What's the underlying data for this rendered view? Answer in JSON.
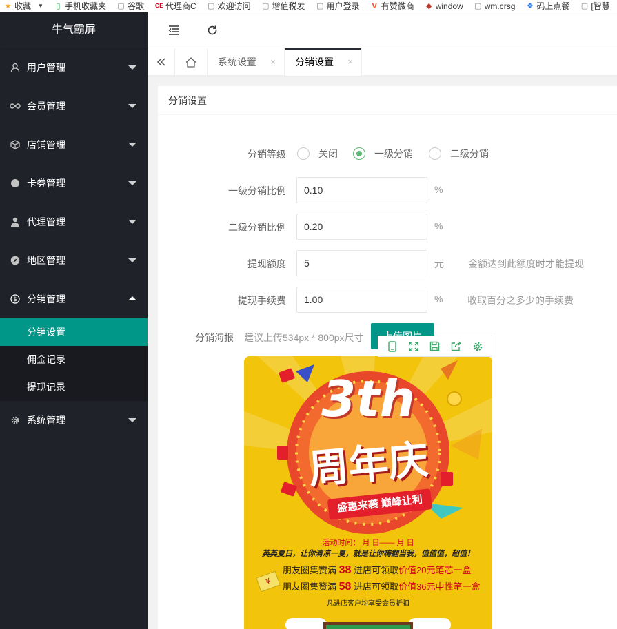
{
  "bookmarks": [
    {
      "icon": "star-icon",
      "label": "收藏"
    },
    {
      "icon": "phone-icon",
      "label": "手机收藏夹"
    },
    {
      "icon": "page-icon",
      "label": "谷歌"
    },
    {
      "icon": "ge-logo-icon",
      "label": "代理商C"
    },
    {
      "icon": "page-icon",
      "label": "欢迎访问"
    },
    {
      "icon": "page-icon",
      "label": "增值税发"
    },
    {
      "icon": "page-icon",
      "label": "用户登录"
    },
    {
      "icon": "v-logo-icon",
      "label": "有赞微商"
    },
    {
      "icon": "shield-logo-icon",
      "label": "window"
    },
    {
      "icon": "page-icon",
      "label": "wm.crsg"
    },
    {
      "icon": "cluster-icon",
      "label": "码上点餐"
    },
    {
      "icon": "page-icon",
      "label": "[智慧"
    }
  ],
  "sidebar": {
    "logo": "牛气霸屏",
    "menus": [
      {
        "icon": "user-icon",
        "label": "用户管理"
      },
      {
        "icon": "infinity-icon",
        "label": "会员管理"
      },
      {
        "icon": "box-icon",
        "label": "店铺管理"
      },
      {
        "icon": "circle-icon",
        "label": "卡劵管理"
      },
      {
        "icon": "person-icon",
        "label": "代理管理"
      },
      {
        "icon": "compass-icon",
        "label": "地区管理"
      },
      {
        "icon": "dollar-icon",
        "label": "分销管理"
      }
    ],
    "submenu": [
      "分销设置",
      "佣金记录",
      "提现记录"
    ],
    "last_menu": {
      "icon": "gear-icon",
      "label": "系统管理"
    }
  },
  "tabs": [
    {
      "label": "系统设置",
      "close": "×"
    },
    {
      "label": "分销设置",
      "close": "×"
    }
  ],
  "card": {
    "title": "分销设置",
    "level_label": "分销等级",
    "level_options": [
      "关闭",
      "一级分销",
      "二级分销"
    ],
    "level_selected": "一级分销",
    "rate1_label": "一级分销比例",
    "rate1_value": "0.10",
    "rate1_unit": "%",
    "rate2_label": "二级分销比例",
    "rate2_value": "0.20",
    "rate2_unit": "%",
    "limit_label": "提现额度",
    "limit_value": "5",
    "limit_unit": "元",
    "limit_hint": "金额达到此额度时才能提现",
    "fee_label": "提现手续费",
    "fee_value": "1.00",
    "fee_unit": "%",
    "fee_hint": "收取百分之多少的手续费",
    "poster_label": "分销海报",
    "poster_hint": "建议上传534px * 800px尺寸",
    "upload_button": "上传图片"
  },
  "poster": {
    "big_num": "3th",
    "big_title": "周年庆",
    "ribbon": "盛惠来袭  巅峰让利",
    "date_line": "活动时间：   月    日——    月    日",
    "slogan": "英英夏日，让你清凉一夏，就是让你嗨翻当我，值值值，超值！",
    "line1_a": "朋友圈集赞满",
    "line1_num": "38",
    "line1_b": "进店可领取",
    "line1_c": "价值20元笔芯一盒",
    "line2_a": "朋友圈集赞满",
    "line2_num": "58",
    "line2_b": "进店可领取",
    "line2_c": "价值36元中性笔一盒",
    "footer": "凡进店客户均享受会员折扣"
  },
  "colors": {
    "sidebar": "#20222a",
    "accent": "#009688",
    "radio": "#5FB878",
    "poster_bg": "#f2c40c"
  }
}
